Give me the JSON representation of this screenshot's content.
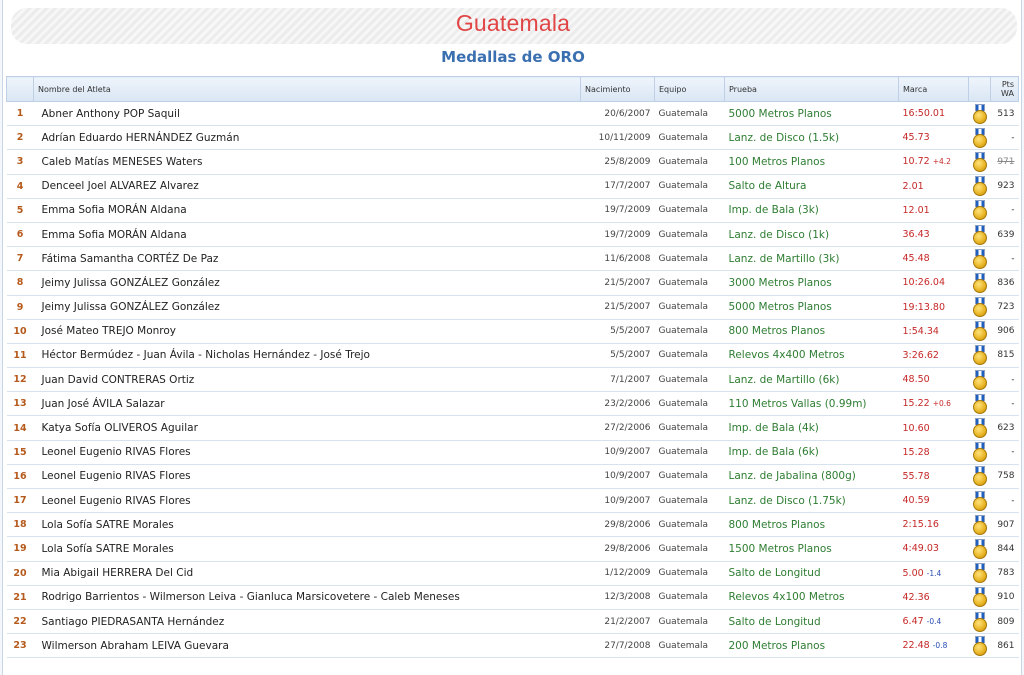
{
  "header": {
    "country": "Guatemala",
    "subtitle": "Medallas de ORO"
  },
  "table": {
    "columns": {
      "name": "Nombre del Atleta",
      "birth": "Nacimiento",
      "team": "Equipo",
      "event": "Prueba",
      "mark": "Marca",
      "pts_line1": "Pts",
      "pts_line2": "WA"
    },
    "rows": [
      {
        "num": "1",
        "name": "Abner Anthony POP Saquil",
        "birth": "20/6/2007",
        "team": "Guatemala",
        "event": "5000 Metros Planos",
        "mark": "16:50.01",
        "wind": "",
        "pts": "513",
        "pts_struck": false
      },
      {
        "num": "2",
        "name": "Adrían Eduardo HERNÁNDEZ Guzmán",
        "birth": "10/11/2009",
        "team": "Guatemala",
        "event": "Lanz. de Disco (1.5k)",
        "mark": "45.73",
        "wind": "",
        "pts": "-",
        "pts_struck": false
      },
      {
        "num": "3",
        "name": "Caleb Matías MENESES Waters",
        "birth": "25/8/2009",
        "team": "Guatemala",
        "event": "100 Metros Planos",
        "mark": "10.72",
        "wind": "+4.2",
        "pts": "971",
        "pts_struck": true
      },
      {
        "num": "4",
        "name": "Denceel Joel ALVAREZ Alvarez",
        "birth": "17/7/2007",
        "team": "Guatemala",
        "event": "Salto de Altura",
        "mark": "2.01",
        "wind": "",
        "pts": "923",
        "pts_struck": false
      },
      {
        "num": "5",
        "name": "Emma Sofia MORÁN Aldana",
        "birth": "19/7/2009",
        "team": "Guatemala",
        "event": "Imp. de Bala (3k)",
        "mark": "12.01",
        "wind": "",
        "pts": "-",
        "pts_struck": false
      },
      {
        "num": "6",
        "name": "Emma Sofia MORÁN Aldana",
        "birth": "19/7/2009",
        "team": "Guatemala",
        "event": "Lanz. de Disco (1k)",
        "mark": "36.43",
        "wind": "",
        "pts": "639",
        "pts_struck": false
      },
      {
        "num": "7",
        "name": "Fátima Samantha CORTÉZ De Paz",
        "birth": "11/6/2008",
        "team": "Guatemala",
        "event": "Lanz. de Martillo (3k)",
        "mark": "45.48",
        "wind": "",
        "pts": "-",
        "pts_struck": false
      },
      {
        "num": "8",
        "name": "Jeimy Julissa GONZÁLEZ González",
        "birth": "21/5/2007",
        "team": "Guatemala",
        "event": "3000 Metros Planos",
        "mark": "10:26.04",
        "wind": "",
        "pts": "836",
        "pts_struck": false
      },
      {
        "num": "9",
        "name": "Jeimy Julissa GONZÁLEZ González",
        "birth": "21/5/2007",
        "team": "Guatemala",
        "event": "5000 Metros Planos",
        "mark": "19:13.80",
        "wind": "",
        "pts": "723",
        "pts_struck": false
      },
      {
        "num": "10",
        "name": "José Mateo TREJO Monroy",
        "birth": "5/5/2007",
        "team": "Guatemala",
        "event": "800 Metros Planos",
        "mark": "1:54.34",
        "wind": "",
        "pts": "906",
        "pts_struck": false
      },
      {
        "num": "11",
        "name": "Héctor Bermúdez - Juan Ávila - Nicholas Hernández - José Trejo",
        "birth": "5/5/2007",
        "team": "Guatemala",
        "event": "Relevos 4x400 Metros",
        "mark": "3:26.62",
        "wind": "",
        "pts": "815",
        "pts_struck": false
      },
      {
        "num": "12",
        "name": "Juan David CONTRERAS Ortiz",
        "birth": "7/1/2007",
        "team": "Guatemala",
        "event": "Lanz. de Martillo (6k)",
        "mark": "48.50",
        "wind": "",
        "pts": "-",
        "pts_struck": false
      },
      {
        "num": "13",
        "name": "Juan José ÁVILA Salazar",
        "birth": "23/2/2006",
        "team": "Guatemala",
        "event": "110 Metros Vallas (0.99m)",
        "mark": "15.22",
        "wind": "+0.6",
        "pts": "-",
        "pts_struck": false
      },
      {
        "num": "14",
        "name": "Katya Sofía OLIVEROS Aguilar",
        "birth": "27/2/2006",
        "team": "Guatemala",
        "event": "Imp. de Bala (4k)",
        "mark": "10.60",
        "wind": "",
        "pts": "623",
        "pts_struck": false
      },
      {
        "num": "15",
        "name": "Leonel Eugenio RIVAS Flores",
        "birth": "10/9/2007",
        "team": "Guatemala",
        "event": "Imp. de Bala (6k)",
        "mark": "15.28",
        "wind": "",
        "pts": "-",
        "pts_struck": false
      },
      {
        "num": "16",
        "name": "Leonel Eugenio RIVAS Flores",
        "birth": "10/9/2007",
        "team": "Guatemala",
        "event": "Lanz. de Jabalina (800g)",
        "mark": "55.78",
        "wind": "",
        "pts": "758",
        "pts_struck": false
      },
      {
        "num": "17",
        "name": "Leonel Eugenio RIVAS Flores",
        "birth": "10/9/2007",
        "team": "Guatemala",
        "event": "Lanz. de Disco (1.75k)",
        "mark": "40.59",
        "wind": "",
        "pts": "-",
        "pts_struck": false
      },
      {
        "num": "18",
        "name": "Lola Sofía SATRE Morales",
        "birth": "29/8/2006",
        "team": "Guatemala",
        "event": "800 Metros Planos",
        "mark": "2:15.16",
        "wind": "",
        "pts": "907",
        "pts_struck": false
      },
      {
        "num": "19",
        "name": "Lola Sofía SATRE Morales",
        "birth": "29/8/2006",
        "team": "Guatemala",
        "event": "1500 Metros Planos",
        "mark": "4:49.03",
        "wind": "",
        "pts": "844",
        "pts_struck": false
      },
      {
        "num": "20",
        "name": "Mia Abigail HERRERA Del Cid",
        "birth": "1/12/2009",
        "team": "Guatemala",
        "event": "Salto de Longitud",
        "mark": "5.00",
        "wind": "-1.4",
        "pts": "783",
        "pts_struck": false
      },
      {
        "num": "21",
        "name": "Rodrigo Barrientos - Wilmerson Leiva - Gianluca Marsicovetere - Caleb Meneses",
        "birth": "12/3/2008",
        "team": "Guatemala",
        "event": "Relevos 4x100 Metros",
        "mark": "42.36",
        "wind": "",
        "pts": "910",
        "pts_struck": false
      },
      {
        "num": "22",
        "name": "Santiago PIEDRASANTA Hernández",
        "birth": "21/2/2007",
        "team": "Guatemala",
        "event": "Salto de Longitud",
        "mark": "6.47",
        "wind": "-0.4",
        "pts": "809",
        "pts_struck": false
      },
      {
        "num": "23",
        "name": "Wilmerson Abraham LEIVA Guevara",
        "birth": "27/7/2008",
        "team": "Guatemala",
        "event": "200 Metros Planos",
        "mark": "22.48",
        "wind": "-0.8",
        "pts": "861",
        "pts_struck": false
      }
    ]
  },
  "icons": {
    "medal": "gold-medal-icon"
  },
  "colors": {
    "country_title": "#e04646",
    "subtitle": "#3a6fb0",
    "row_number": "#b65a1c",
    "event": "#2e7d32",
    "mark": "#c62828",
    "wind_negative": "#2a4fb5"
  }
}
